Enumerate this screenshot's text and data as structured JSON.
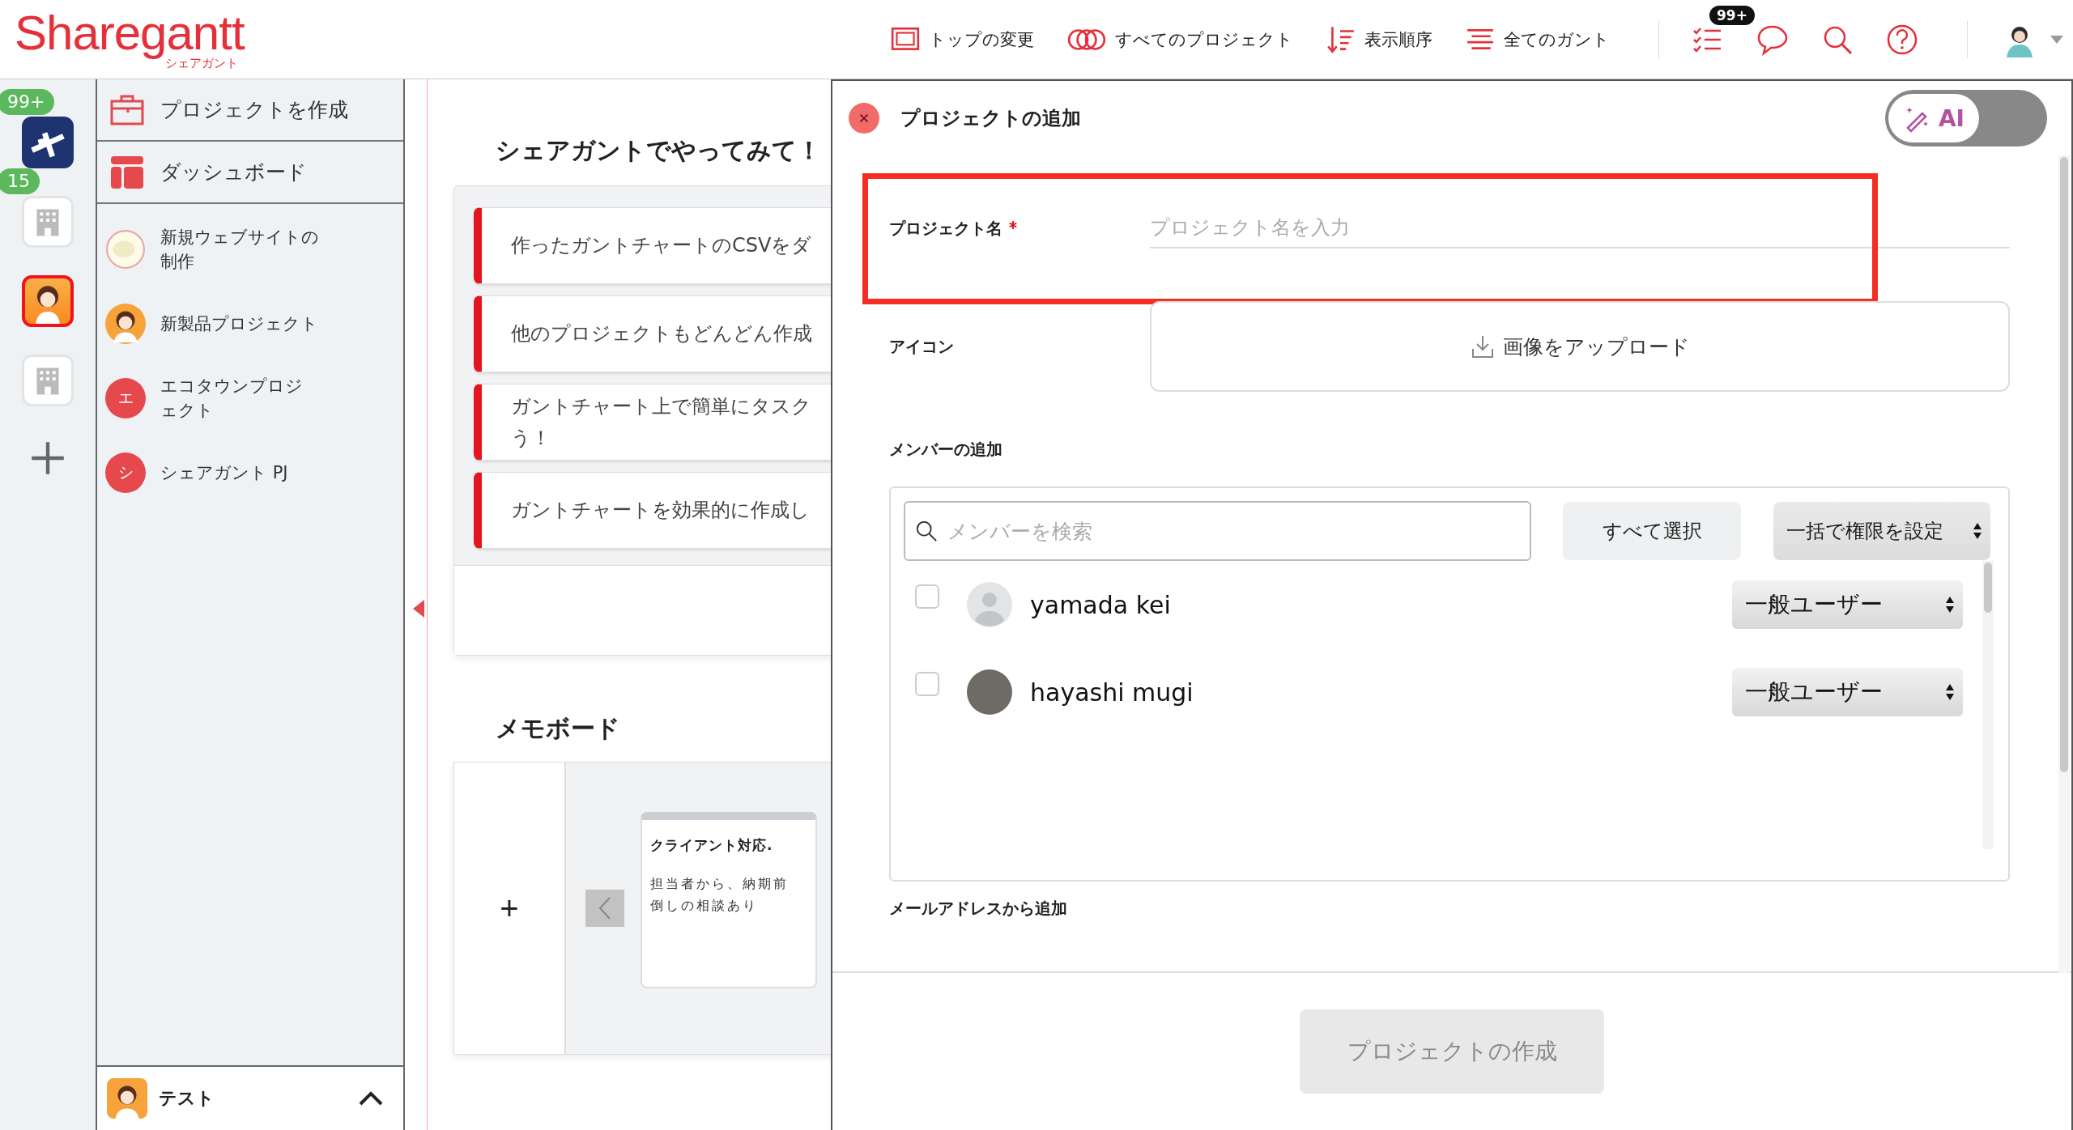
{
  "header": {
    "logo": "Sharegantt",
    "logo_sub": "シェアガント",
    "nav": [
      {
        "label": "トップの変更",
        "kind": "screen"
      },
      {
        "label": "すべてのプロジェクト",
        "kind": "rings"
      },
      {
        "label": "表示順序",
        "kind": "sort"
      },
      {
        "label": "全てのガント",
        "kind": "lines"
      }
    ],
    "task_badge": "99+"
  },
  "rail": [
    {
      "kind": "plane",
      "badge": "99+",
      "selected": false
    },
    {
      "kind": "building",
      "badge": "15",
      "selected": false
    },
    {
      "kind": "character",
      "selected": true
    },
    {
      "kind": "building",
      "selected": false
    }
  ],
  "sidebar": {
    "actions": [
      {
        "label": "プロジェクトを作成",
        "kind": "briefcase"
      },
      {
        "label": "ダッシュボード",
        "kind": "dashboard"
      }
    ],
    "projects": [
      {
        "name": "新規ウェブサイトの制作",
        "kind": "image"
      },
      {
        "name": "新製品プロジェクト",
        "kind": "character"
      },
      {
        "name": "エコタウンプロジェクト",
        "kind": "initial",
        "initial": "エ"
      },
      {
        "name": "シェアガント PJ",
        "kind": "initial",
        "initial": "シ"
      }
    ],
    "footer": {
      "name": "テスト",
      "expanded": false
    }
  },
  "tips": {
    "title": "シェアガントでやってみて！",
    "items": [
      {
        "lines": [
          "作ったガントチャートのCSVをダ"
        ]
      },
      {
        "lines": [
          "他のプロジェクトもどんどん作成"
        ]
      },
      {
        "lines": [
          "ガントチャート上で簡単にタスク",
          "う！"
        ]
      },
      {
        "lines": [
          "ガントチャートを効果的に作成し"
        ]
      }
    ]
  },
  "memo_board": {
    "title": "メモボード",
    "add": "+",
    "memos": [
      {
        "title": "クライアント対応.",
        "body": "担当者から、納期前倒しの相談あり"
      }
    ]
  },
  "dialog": {
    "title": "プロジェクトの追加",
    "ai_toggle": {
      "label": "AI",
      "on": false
    },
    "project_name": {
      "label": "プロジェクト名",
      "required": true,
      "placeholder": "プロジェクト名を入力",
      "highlighted": true
    },
    "icon": {
      "label": "アイコン",
      "upload": "画像をアップロード"
    },
    "members": {
      "label": "メンバーの追加",
      "search_placeholder": "メンバーを検索",
      "select_all": "すべて選択",
      "bulk_role": "一括で権限を設定",
      "rows": [
        {
          "name": "yamada kei",
          "checked": false,
          "kind": "default",
          "role": "一般ユーザー"
        },
        {
          "name": "hayashi mugi",
          "checked": false,
          "kind": "photo",
          "role": "一般ユーザー"
        }
      ]
    },
    "email_label": "メールアドレスから追加",
    "create_button": {
      "label": "プロジェクトの作成",
      "disabled": true
    }
  }
}
